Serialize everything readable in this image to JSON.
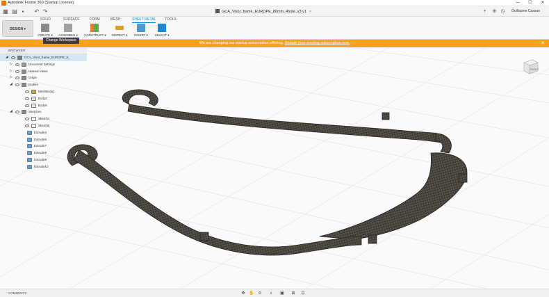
{
  "window": {
    "title": "Autodesk Fusion 360 (Startup License)",
    "controls": [
      "—",
      "☐",
      "✕"
    ]
  },
  "doc_tab": {
    "label": "GCA_Visor_frame_EUROPE_80mm_4hole_v3 v1",
    "close": "×"
  },
  "user": {
    "name": "Guillaume Cassan"
  },
  "ribbon": {
    "workspace": "DESIGN ▾",
    "tabs": [
      "SOLID",
      "SURFACE",
      "FORM",
      "MESH",
      "SHEET METAL",
      "TOOLS"
    ],
    "active_tab": "SHEET METAL",
    "groups": [
      {
        "label": "CREATE ▾",
        "icon": "create-icon",
        "color": "#8b8b8b"
      },
      {
        "label": "ASSEMBLE ▾",
        "icon": "assemble-icon",
        "color": "#a0a0a0"
      },
      {
        "label": "CONSTRUCT ▾",
        "icon": "construct-icon",
        "color": "#e07b39"
      },
      {
        "label": "INSPECT ▾",
        "icon": "inspect-icon",
        "color": "#d9a326"
      },
      {
        "label": "INSERT ▾",
        "icon": "insert-icon",
        "color": "#4a9bd4"
      },
      {
        "label": "SELECT ▾",
        "icon": "select-icon",
        "color": "#1e88d1"
      }
    ]
  },
  "tooltip": {
    "text": "Change Workspace"
  },
  "banner": {
    "text": "We are changing our startup subscription offering.",
    "link": "Update your existing subscription now.",
    "close": "✕"
  },
  "browser": {
    "header": "BROWSER",
    "items": [
      {
        "label": "GCA_Visor_frame_EUROPE_8...",
        "indent": 0,
        "tri": "◢",
        "icon": "component-icon",
        "root": true
      },
      {
        "label": "Document Settings",
        "indent": 1,
        "tri": "▷",
        "icon": "gear-icon"
      },
      {
        "label": "Named Views",
        "indent": 1,
        "tri": "▷",
        "icon": "folder-icon"
      },
      {
        "label": "Origin",
        "indent": 1,
        "tri": "▷",
        "icon": "folder-icon"
      },
      {
        "label": "Bodies",
        "indent": 1,
        "tri": "◢",
        "icon": "folder-icon"
      },
      {
        "label": "MeshBody1",
        "indent": 2,
        "tri": "",
        "icon": "mesh-body-icon"
      },
      {
        "label": "Body2",
        "indent": 2,
        "tri": "",
        "icon": "body-icon"
      },
      {
        "label": "Body6",
        "indent": 2,
        "tri": "",
        "icon": "body-icon"
      },
      {
        "label": "Sketches",
        "indent": 1,
        "tri": "◢",
        "icon": "folder-icon"
      },
      {
        "label": "Sketch4",
        "indent": 2,
        "tri": "",
        "icon": "sketch-icon"
      },
      {
        "label": "Sketch5",
        "indent": 2,
        "tri": "",
        "icon": "sketch-icon"
      },
      {
        "label": "Extrude3",
        "indent": 0,
        "tri": "",
        "icon": "extrude-icon"
      },
      {
        "label": "Extrude5",
        "indent": 0,
        "tri": "",
        "icon": "extrude-icon"
      },
      {
        "label": "Extrude7",
        "indent": 0,
        "tri": "",
        "icon": "extrude-icon"
      },
      {
        "label": "Extrude8",
        "indent": 0,
        "tri": "",
        "icon": "extrude-icon"
      },
      {
        "label": "Extrude9",
        "indent": 0,
        "tri": "",
        "icon": "extrude-icon"
      },
      {
        "label": "Extrude10",
        "indent": 0,
        "tri": "",
        "icon": "extrude-icon"
      }
    ]
  },
  "viewcube": {
    "label": "RIGHT"
  },
  "statusbar": {
    "comments": "COMMENTS",
    "tools": [
      "✥",
      "✋",
      "⊙",
      "⌕",
      "▣",
      "⊞",
      "⊡"
    ]
  }
}
